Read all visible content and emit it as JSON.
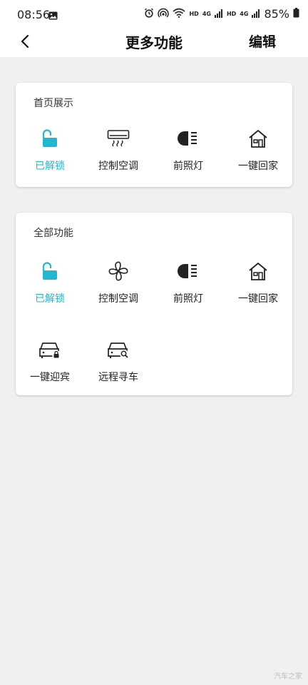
{
  "status": {
    "time": "08:56",
    "battery": "85%",
    "hd1": "HD",
    "net1": "4G",
    "hd2": "HD",
    "net2": "4G",
    "icons": [
      "photo-icon",
      "alarm-icon",
      "hotspot-icon",
      "wifi-icon",
      "signal-icon",
      "battery-icon"
    ]
  },
  "header": {
    "back_icon": "chevron-left-icon",
    "title": "更多功能",
    "edit_label": "编辑"
  },
  "home_section": {
    "title": "首页展示",
    "items": [
      {
        "label": "已解锁",
        "icon": "unlock-icon",
        "active": true
      },
      {
        "label": "控制空调",
        "icon": "air-conditioner-icon",
        "active": false
      },
      {
        "label": "前照灯",
        "icon": "headlight-icon",
        "active": false
      },
      {
        "label": "一键回家",
        "icon": "home-icon",
        "active": false
      }
    ]
  },
  "all_section": {
    "title": "全部功能",
    "items": [
      {
        "label": "已解锁",
        "icon": "unlock-icon",
        "active": true
      },
      {
        "label": "控制空调",
        "icon": "fan-icon",
        "active": false
      },
      {
        "label": "前照灯",
        "icon": "headlight-icon",
        "active": false
      },
      {
        "label": "一键回家",
        "icon": "home-icon",
        "active": false
      },
      {
        "label": "一键迎宾",
        "icon": "car-lock-icon",
        "active": false
      },
      {
        "label": "远程寻车",
        "icon": "car-search-icon",
        "active": false
      }
    ]
  },
  "watermark": "汽车之家",
  "colors": {
    "accent": "#1fb8d0",
    "background": "#f0f0f0",
    "card": "#ffffff"
  }
}
